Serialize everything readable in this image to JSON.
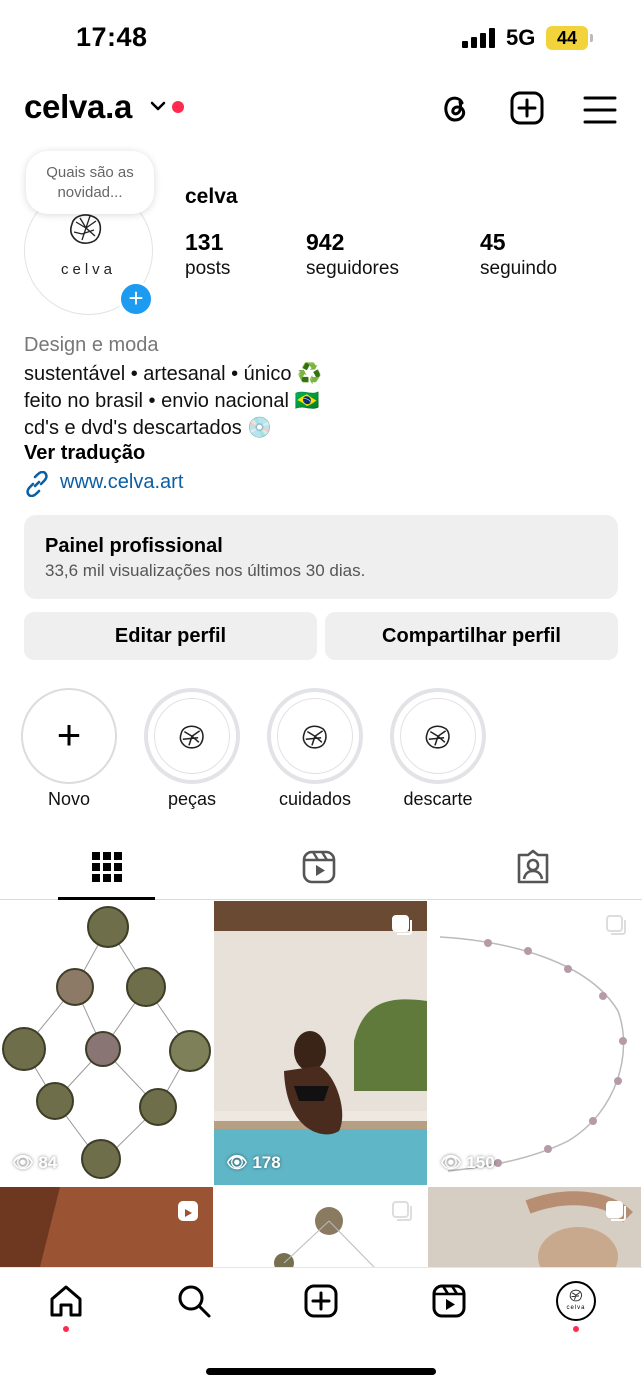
{
  "status_bar": {
    "time": "17:48",
    "network": "5G",
    "battery": "44"
  },
  "header": {
    "username": "celva.a",
    "icons": [
      "chevron-down-icon",
      "threads-icon",
      "new-post-icon",
      "menu-icon"
    ]
  },
  "profile": {
    "note_bubble": "Quais são as novidad...",
    "avatar_text": "celva",
    "display_name": "celva",
    "stats": {
      "posts": {
        "value": "131",
        "label": "posts"
      },
      "followers": {
        "value": "942",
        "label": "seguidores"
      },
      "following": {
        "value": "45",
        "label": "seguindo"
      }
    },
    "category": "Design e moda",
    "bio": [
      "sustentável • artesanal • único ♻️",
      "feito no brasil • envio nacional 🇧🇷",
      "cd's e dvd's descartados 💿"
    ],
    "translate": "Ver tradução",
    "link": "www.celva.art"
  },
  "panel": {
    "title": "Painel profissional",
    "subtitle": "33,6 mil visualizações nos últimos 30 dias."
  },
  "buttons": {
    "edit": "Editar perfil",
    "share": "Compartilhar perfil"
  },
  "highlights": [
    {
      "label": "Novo"
    },
    {
      "label": "peças"
    },
    {
      "label": "cuidados"
    },
    {
      "label": "descarte"
    }
  ],
  "tabs": [
    "grid-icon",
    "reels-icon",
    "tagged-icon"
  ],
  "grid": [
    {
      "views": "84"
    },
    {
      "views": "178"
    },
    {
      "views": "150"
    }
  ],
  "colors": {
    "accent_blue": "#1d9bf0",
    "notification_red": "#ff2a4d",
    "battery": "#f2d33b"
  }
}
